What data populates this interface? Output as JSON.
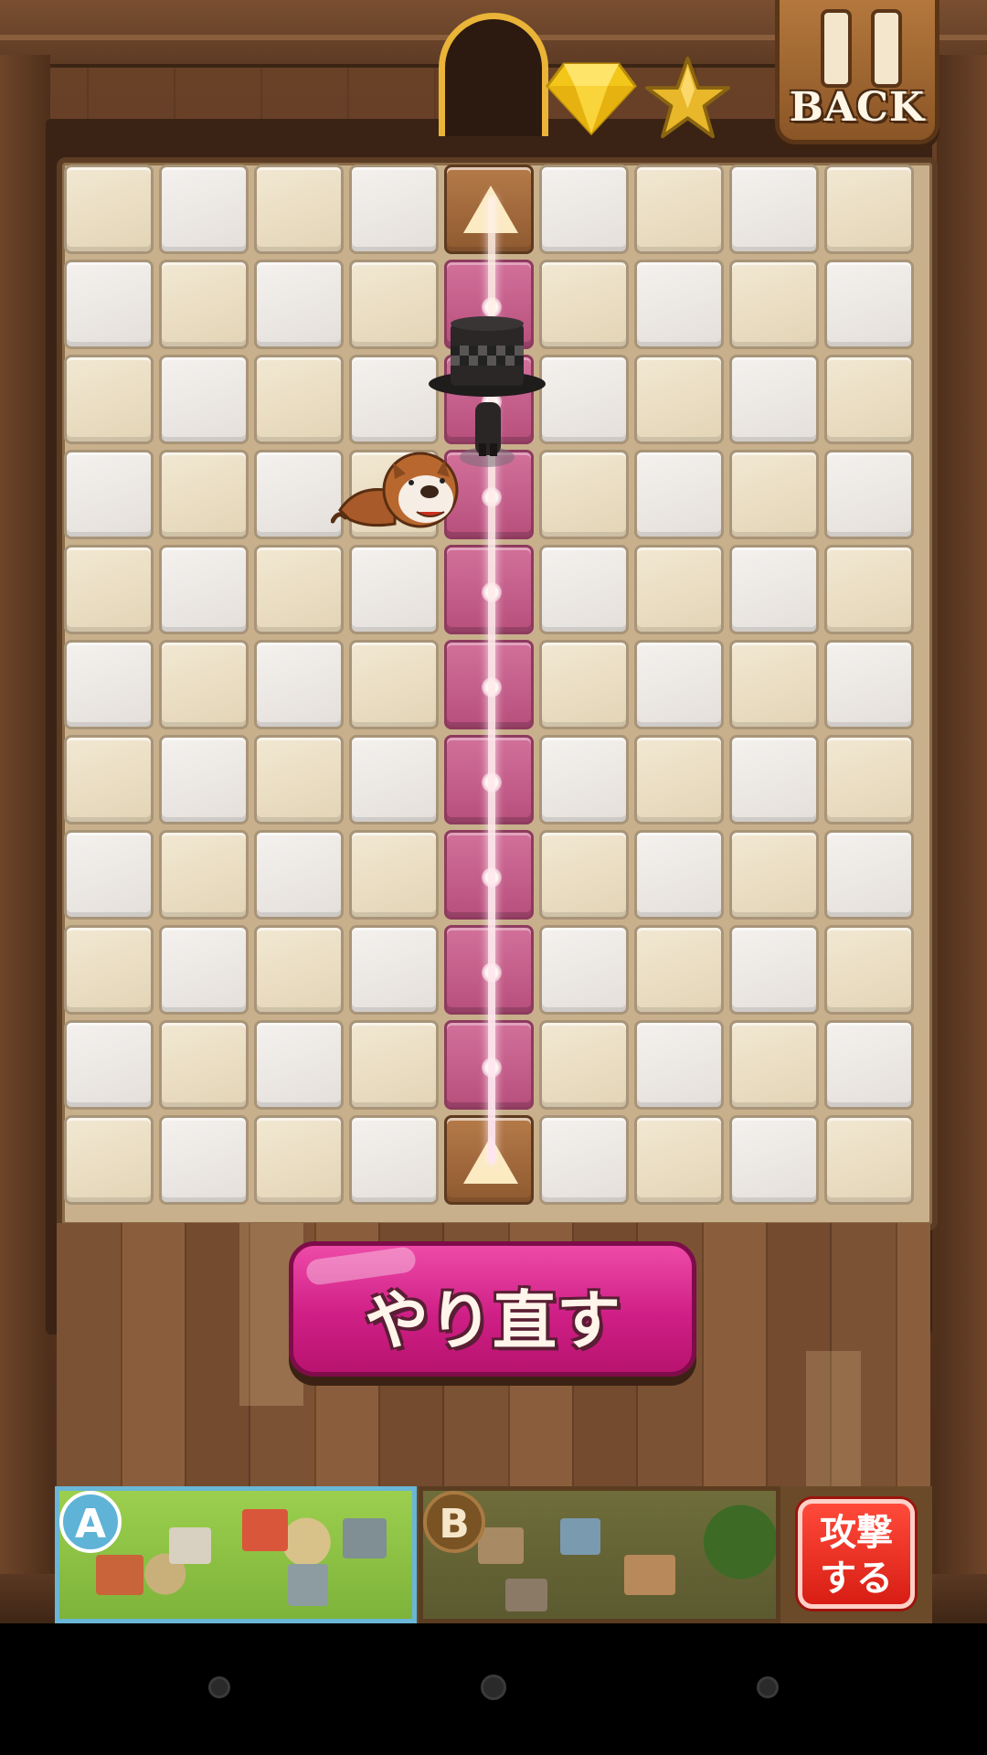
{
  "header": {
    "back_label": "BACK",
    "door_icon": "exit-door-icon",
    "gem_icon": "yellow-gem-icon",
    "star_icon": "gold-star-icon"
  },
  "board": {
    "columns": 9,
    "rows": 11,
    "path_column": 5,
    "start_arrow": "arrow-up-icon",
    "end_arrow": "arrow-up-icon",
    "characters": [
      "top-hat-character",
      "bulldog-character"
    ]
  },
  "controls": {
    "retry_label": "やり直す",
    "retry_color": "#cf1f86"
  },
  "banner": {
    "village_a_badge": "A",
    "village_b_badge": "B",
    "attack_line1": "攻撃",
    "attack_line2": "する",
    "attack_color": "#e02a1d"
  },
  "navbar": {
    "buttons": [
      "back-nav",
      "home-nav",
      "recents-nav"
    ]
  }
}
